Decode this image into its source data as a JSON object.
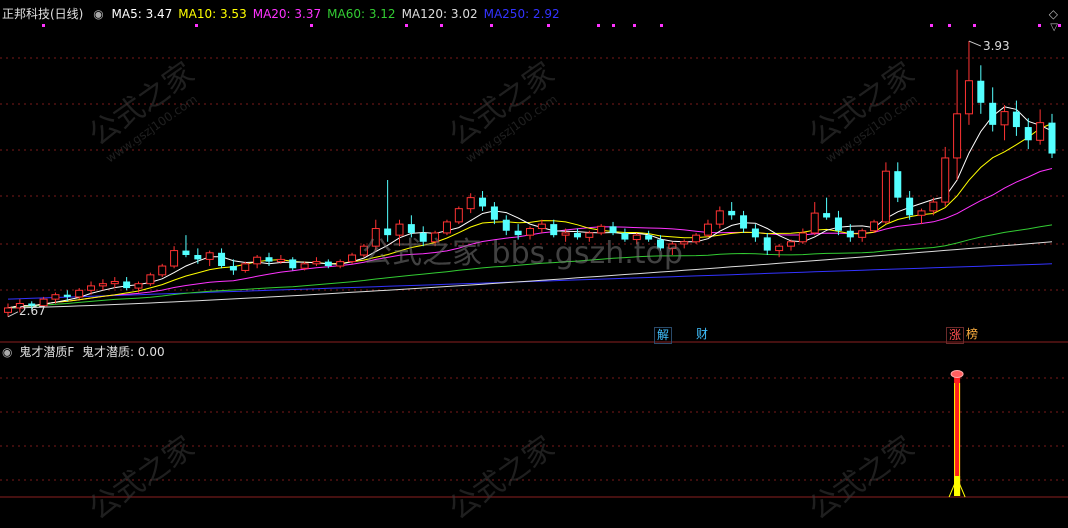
{
  "header": {
    "title": "正邦科技(日线)",
    "ma": [
      {
        "label": "MA5:",
        "value": "3.47",
        "color": "#ffffff"
      },
      {
        "label": "MA10:",
        "value": "3.53",
        "color": "#ffff00"
      },
      {
        "label": "MA20:",
        "value": "3.37",
        "color": "#ff33ff"
      },
      {
        "label": "MA60:",
        "value": "3.12",
        "color": "#33cc33"
      },
      {
        "label": "MA120:",
        "value": "3.02",
        "color": "#dddddd"
      },
      {
        "label": "MA250:",
        "value": "2.92",
        "color": "#3333ff"
      }
    ]
  },
  "sub_header": {
    "indicator": "鬼才潜质F",
    "label": "鬼才潜质:",
    "value": "0.00"
  },
  "badges": {
    "jie": "解",
    "cai": "财",
    "zhang": "涨",
    "bang": "榜"
  },
  "watermark": {
    "main": "公式之家",
    "url": "www.gszj100.com",
    "center": "公式之家 bbs.gszh.top"
  },
  "chart_data": {
    "type": "candlestick",
    "high_label": "3.93",
    "low_label": "2.67",
    "colors": {
      "up": "#ff3333",
      "down": "#54ffff",
      "ma5": "#ffffff",
      "ma10": "#ffff00",
      "ma20": "#ff33ff",
      "ma60": "#33cc33",
      "ma120": "#dddddd",
      "ma250": "#3333ff"
    },
    "candles": [
      [
        2.7,
        2.74,
        2.68,
        2.72
      ],
      [
        2.72,
        2.76,
        2.7,
        2.74
      ],
      [
        2.74,
        2.75,
        2.71,
        2.73
      ],
      [
        2.73,
        2.77,
        2.72,
        2.76
      ],
      [
        2.76,
        2.79,
        2.74,
        2.78
      ],
      [
        2.78,
        2.8,
        2.75,
        2.77
      ],
      [
        2.77,
        2.81,
        2.76,
        2.8
      ],
      [
        2.8,
        2.84,
        2.78,
        2.82
      ],
      [
        2.82,
        2.85,
        2.8,
        2.83
      ],
      [
        2.83,
        2.86,
        2.81,
        2.84
      ],
      [
        2.84,
        2.86,
        2.8,
        2.81
      ],
      [
        2.81,
        2.84,
        2.79,
        2.83
      ],
      [
        2.83,
        2.88,
        2.82,
        2.87
      ],
      [
        2.87,
        2.92,
        2.86,
        2.91
      ],
      [
        2.91,
        3.0,
        2.9,
        2.98
      ],
      [
        2.98,
        3.05,
        2.95,
        2.96
      ],
      [
        2.96,
        2.99,
        2.92,
        2.94
      ],
      [
        2.94,
        2.98,
        2.91,
        2.97
      ],
      [
        2.97,
        2.99,
        2.9,
        2.91
      ],
      [
        2.91,
        2.94,
        2.87,
        2.89
      ],
      [
        2.89,
        2.93,
        2.88,
        2.92
      ],
      [
        2.92,
        2.96,
        2.9,
        2.95
      ],
      [
        2.95,
        2.97,
        2.91,
        2.93
      ],
      [
        2.93,
        2.96,
        2.92,
        2.94
      ],
      [
        2.94,
        2.95,
        2.89,
        2.9
      ],
      [
        2.9,
        2.93,
        2.89,
        2.92
      ],
      [
        2.92,
        2.95,
        2.91,
        2.93
      ],
      [
        2.93,
        2.94,
        2.9,
        2.91
      ],
      [
        2.91,
        2.94,
        2.9,
        2.93
      ],
      [
        2.93,
        2.97,
        2.92,
        2.96
      ],
      [
        2.96,
        3.01,
        2.95,
        3.0
      ],
      [
        3.0,
        3.12,
        2.98,
        3.08
      ],
      [
        3.08,
        3.3,
        3.02,
        3.05
      ],
      [
        3.05,
        3.12,
        3.0,
        3.1
      ],
      [
        3.1,
        3.14,
        3.04,
        3.06
      ],
      [
        3.06,
        3.09,
        3.0,
        3.02
      ],
      [
        3.02,
        3.07,
        3.0,
        3.06
      ],
      [
        3.06,
        3.12,
        3.05,
        3.11
      ],
      [
        3.11,
        3.18,
        3.1,
        3.17
      ],
      [
        3.17,
        3.24,
        3.15,
        3.22
      ],
      [
        3.22,
        3.25,
        3.16,
        3.18
      ],
      [
        3.18,
        3.2,
        3.1,
        3.12
      ],
      [
        3.12,
        3.14,
        3.05,
        3.07
      ],
      [
        3.07,
        3.1,
        3.03,
        3.05
      ],
      [
        3.05,
        3.09,
        3.03,
        3.08
      ],
      [
        3.08,
        3.12,
        3.06,
        3.1
      ],
      [
        3.1,
        3.12,
        3.04,
        3.05
      ],
      [
        3.05,
        3.08,
        3.02,
        3.06
      ],
      [
        3.06,
        3.08,
        3.03,
        3.04
      ],
      [
        3.04,
        3.07,
        3.02,
        3.06
      ],
      [
        3.06,
        3.1,
        3.05,
        3.09
      ],
      [
        3.09,
        3.11,
        3.05,
        3.06
      ],
      [
        3.06,
        3.08,
        3.02,
        3.03
      ],
      [
        3.03,
        3.06,
        3.01,
        3.05
      ],
      [
        3.05,
        3.07,
        3.02,
        3.03
      ],
      [
        3.03,
        3.05,
        2.98,
        2.99
      ],
      [
        2.99,
        3.02,
        2.96,
        3.01
      ],
      [
        3.01,
        3.03,
        2.99,
        3.02
      ],
      [
        3.02,
        3.06,
        3.01,
        3.05
      ],
      [
        3.05,
        3.12,
        3.04,
        3.1
      ],
      [
        3.1,
        3.18,
        3.08,
        3.16
      ],
      [
        3.16,
        3.2,
        3.12,
        3.14
      ],
      [
        3.14,
        3.16,
        3.06,
        3.08
      ],
      [
        3.08,
        3.1,
        3.02,
        3.04
      ],
      [
        3.04,
        3.06,
        2.96,
        2.98
      ],
      [
        2.98,
        3.01,
        2.95,
        3.0
      ],
      [
        3.0,
        3.03,
        2.98,
        3.02
      ],
      [
        3.02,
        3.08,
        3.01,
        3.06
      ],
      [
        3.06,
        3.2,
        3.05,
        3.15
      ],
      [
        3.15,
        3.22,
        3.12,
        3.13
      ],
      [
        3.13,
        3.16,
        3.05,
        3.07
      ],
      [
        3.07,
        3.1,
        3.02,
        3.04
      ],
      [
        3.04,
        3.08,
        3.02,
        3.07
      ],
      [
        3.07,
        3.12,
        3.06,
        3.11
      ],
      [
        3.11,
        3.38,
        3.1,
        3.34
      ],
      [
        3.34,
        3.38,
        3.2,
        3.22
      ],
      [
        3.22,
        3.25,
        3.12,
        3.14
      ],
      [
        3.14,
        3.17,
        3.1,
        3.16
      ],
      [
        3.16,
        3.22,
        3.14,
        3.2
      ],
      [
        3.2,
        3.45,
        3.18,
        3.4
      ],
      [
        3.4,
        3.8,
        3.3,
        3.6
      ],
      [
        3.6,
        3.93,
        3.55,
        3.75
      ],
      [
        3.75,
        3.82,
        3.6,
        3.65
      ],
      [
        3.65,
        3.72,
        3.52,
        3.55
      ],
      [
        3.55,
        3.64,
        3.48,
        3.61
      ],
      [
        3.61,
        3.66,
        3.5,
        3.54
      ],
      [
        3.54,
        3.58,
        3.44,
        3.48
      ],
      [
        3.48,
        3.62,
        3.46,
        3.56
      ],
      [
        3.56,
        3.6,
        3.4,
        3.42
      ]
    ]
  }
}
